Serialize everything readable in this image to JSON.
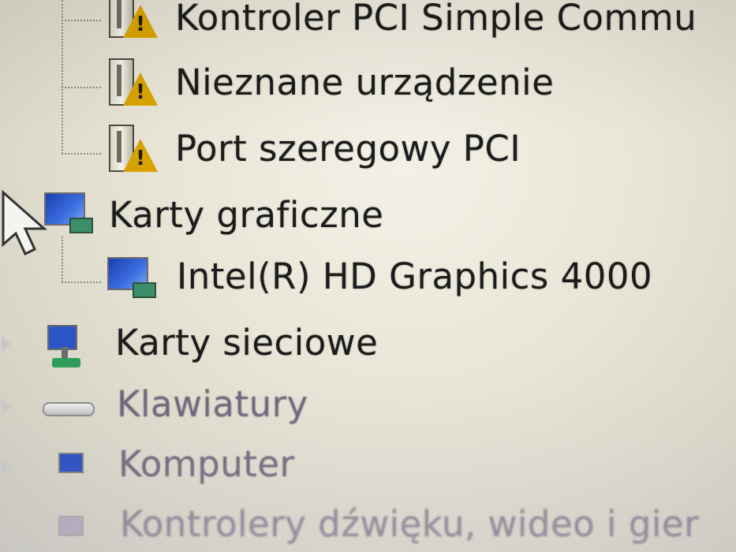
{
  "tree": {
    "items": [
      {
        "label": "Kontroler PCI Simple Commu",
        "icon": "device-warning-icon"
      },
      {
        "label": "Nieznane urządzenie",
        "icon": "device-warning-icon"
      },
      {
        "label": "Port szeregowy PCI",
        "icon": "device-warning-icon"
      },
      {
        "label": "Karty graficzne",
        "icon": "display-adapter-icon"
      },
      {
        "label": "Intel(R) HD Graphics 4000",
        "icon": "display-adapter-icon"
      },
      {
        "label": "Karty sieciowe",
        "icon": "network-adapter-icon"
      },
      {
        "label": "Klawiatury",
        "icon": "keyboard-icon"
      },
      {
        "label": "Komputer",
        "icon": "computer-icon"
      },
      {
        "label": "Kontrolery dźwięku, wideo i gier",
        "icon": "sound-controller-icon"
      }
    ]
  },
  "colors": {
    "text": "#1c1c1c",
    "warning": "#d8a300",
    "display_blue": "#2c56c8",
    "connector_green": "#3c8d6a"
  }
}
